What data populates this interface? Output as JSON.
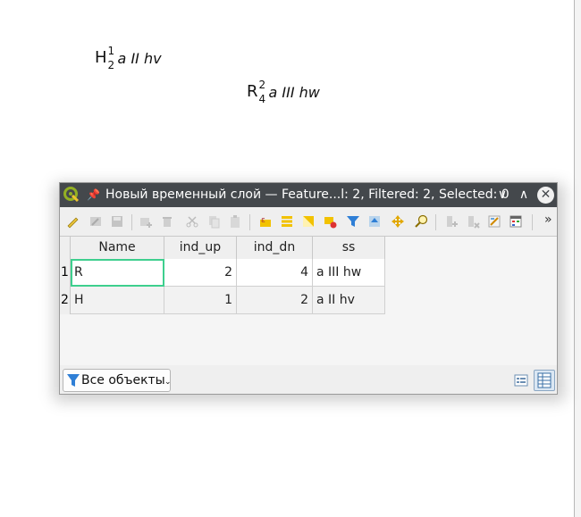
{
  "map_labels": [
    {
      "symbol": "H",
      "sup": "1",
      "sub": "2",
      "text": "a II hv"
    },
    {
      "symbol": "R",
      "sup": "2",
      "sub": "4",
      "text": "a III hw"
    }
  ],
  "window": {
    "title": "Новый временный слой — Feature...l: 2, Filtered: 2, Selected: 0",
    "minimize_glyph": "∨",
    "maximize_glyph": "∧",
    "close_glyph": "✕"
  },
  "toolbar": {
    "overflow_glyph": "»",
    "icons": [
      "toggle-edit-icon",
      "multi-edit-icon",
      "save-edits-icon",
      "add-feature-icon",
      "delete-feature-icon",
      "cut-icon",
      "copy-icon",
      "paste-icon",
      "expression-select-icon",
      "select-all-icon",
      "invert-selection-icon",
      "deselect-icon",
      "filter-selection-icon",
      "move-selection-top-icon",
      "pan-to-selection-icon",
      "zoom-to-selection-icon",
      "new-field-icon",
      "delete-field-icon",
      "field-calculator-icon",
      "conditional-format-icon"
    ]
  },
  "table": {
    "columns": [
      "Name",
      "ind_up",
      "ind_dn",
      "ss"
    ],
    "rows": [
      {
        "num": "1",
        "Name": "R",
        "ind_up": "2",
        "ind_dn": "4",
        "ss": "a III hw"
      },
      {
        "num": "2",
        "Name": "H",
        "ind_up": "1",
        "ind_dn": "2",
        "ss": "a II hv"
      }
    ]
  },
  "footer": {
    "filter_label": "Все объекты",
    "filter_dropdown_glyph": "⌄"
  },
  "colors": {
    "titlebar": "#44484c",
    "selection_border": "#3ecf8e",
    "filter_icon": "#2f7fd6"
  }
}
